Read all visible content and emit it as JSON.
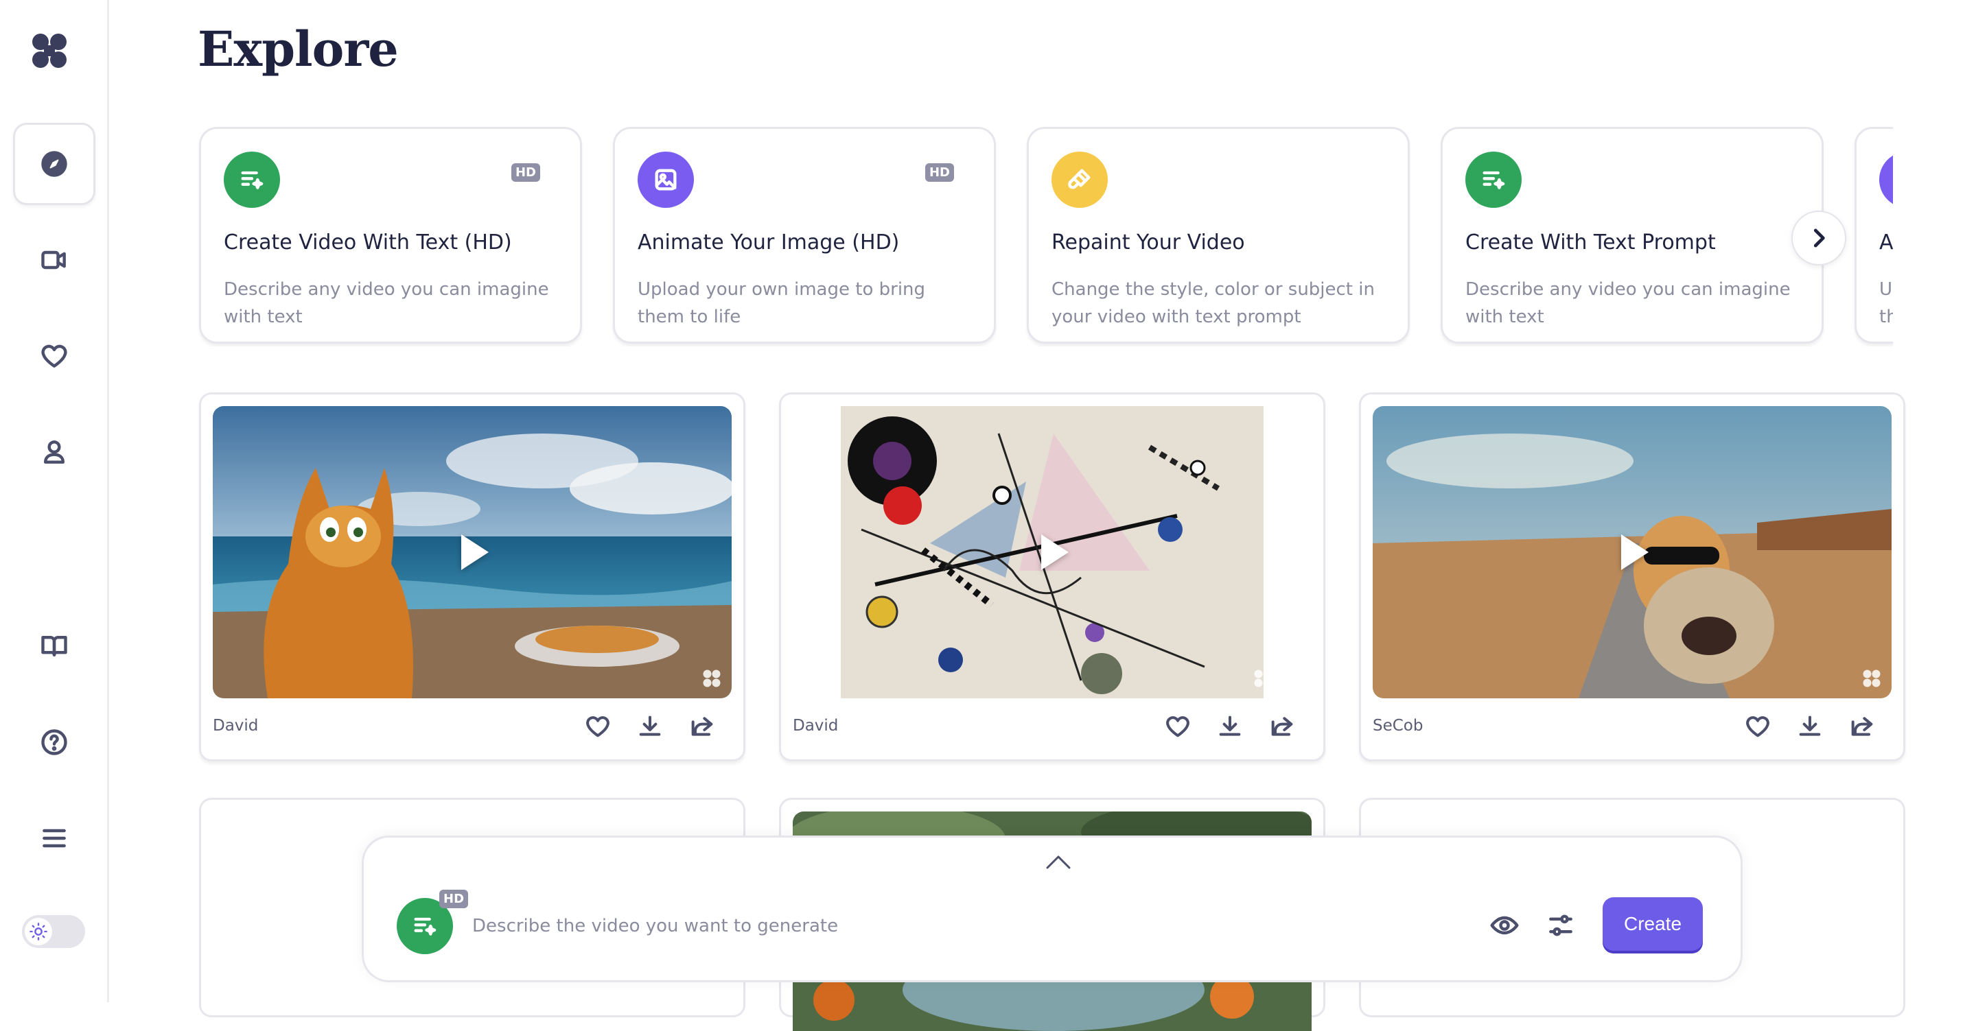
{
  "page": {
    "title": "Explore"
  },
  "sidebar": {
    "items": [
      {
        "name": "explore",
        "icon": "compass-icon",
        "active": true
      },
      {
        "name": "videos",
        "icon": "video-camera-icon",
        "active": false
      },
      {
        "name": "favorites",
        "icon": "heart-icon",
        "active": false
      },
      {
        "name": "profile",
        "icon": "user-icon",
        "active": false
      },
      {
        "name": "docs",
        "icon": "book-icon",
        "active": false
      },
      {
        "name": "help",
        "icon": "help-circle-icon",
        "active": false
      },
      {
        "name": "menu",
        "icon": "menu-icon",
        "active": false
      }
    ],
    "theme_toggle": {
      "icon": "sun-icon",
      "mode": "light"
    }
  },
  "features": [
    {
      "title": "Create Video With Text (HD)",
      "description": "Describe any video you can imagine with text",
      "badge": "HD",
      "color": "#2ea55a",
      "icon": "text-sparkle-icon"
    },
    {
      "title": "Animate Your Image (HD)",
      "description": "Upload your own image to bring them to life",
      "badge": "HD",
      "color": "#7a5cf0",
      "icon": "image-icon"
    },
    {
      "title": "Repaint Your Video",
      "description": "Change the style, color or subject in your video with text prompt",
      "badge": "",
      "color": "#f7c948",
      "icon": "paint-brush-icon"
    },
    {
      "title": "Create With Text Prompt",
      "description": "Describe any video you can imagine with text",
      "badge": "",
      "color": "#2ea55a",
      "icon": "text-sparkle-icon"
    },
    {
      "title": "Animate Your Image",
      "description": "Upload your own image to bring them to life",
      "badge": "",
      "color": "#7a5cf0",
      "icon": "image-icon"
    }
  ],
  "videos": [
    {
      "author": "David",
      "thumb": "cat-on-beach"
    },
    {
      "author": "David",
      "thumb": "abstract-painting"
    },
    {
      "author": "SeCob",
      "thumb": "cat-and-dog-running"
    }
  ],
  "prompt": {
    "placeholder": "Describe the video you want to generate",
    "badge": "HD",
    "create_label": "Create",
    "accent": "#6c5ce7"
  }
}
